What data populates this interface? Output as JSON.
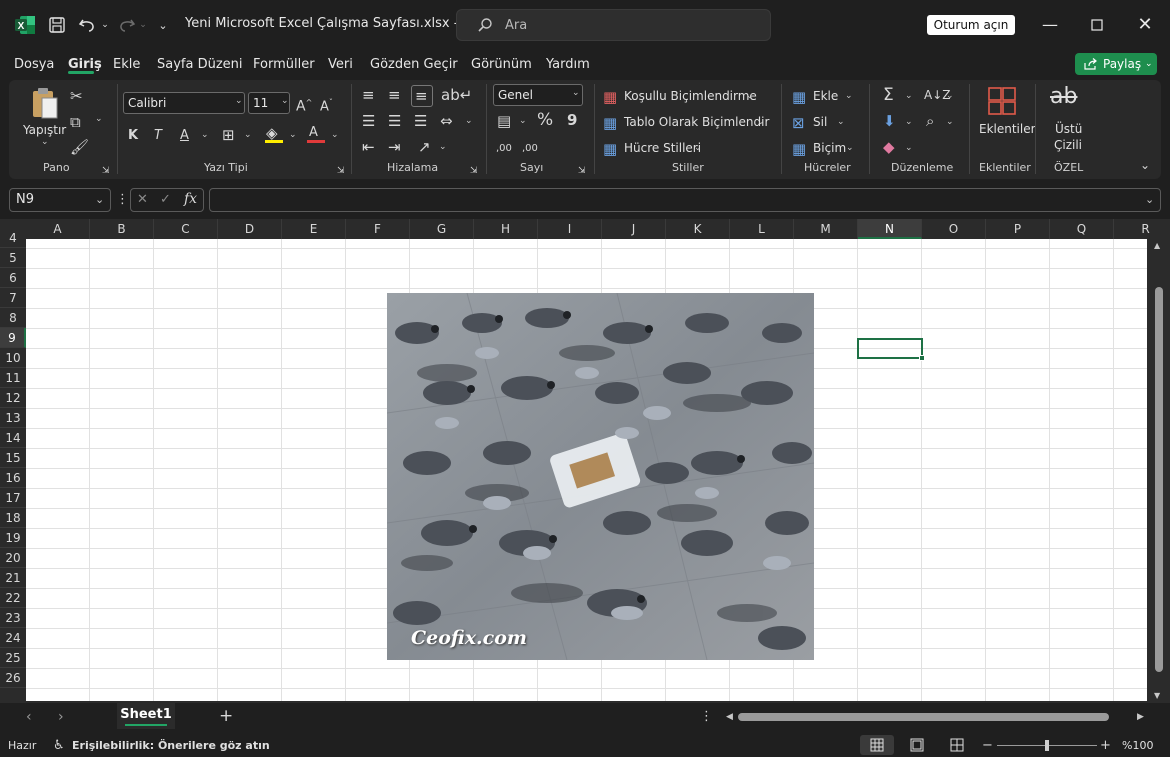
{
  "title": {
    "doc": "Yeni Microsoft Excel Çalışma Sayfası.xlsx  -  E...",
    "search_placeholder": "Ara",
    "signin": "Oturum açın"
  },
  "menu": [
    "Dosya",
    "Giriş",
    "Ekle",
    "Sayfa Düzeni",
    "Formüller",
    "Veri",
    "Gözden Geçir",
    "Görünüm",
    "Yardım"
  ],
  "share": "Paylaş",
  "ribbon": {
    "paste": "Yapıştır",
    "font_name": "Calibri",
    "font_size": "11",
    "bold": "K",
    "italic": "T",
    "underline": "A",
    "font_color": "A",
    "number_format": "Genel",
    "percent": "%",
    "comma": "9",
    "dec_inc": ",00",
    "dec_dec": ",00",
    "cond_format": "Koşullu Biçimlendirme",
    "table_format": "Tablo Olarak Biçimlendir",
    "cell_styles": "Hücre Stilleri",
    "insert": "Ekle",
    "delete": "Sil",
    "format": "Biçim",
    "addins": "Eklentiler",
    "strike_line1": "Üstü",
    "strike_line2": "Çizili",
    "groups": {
      "pano": "Pano",
      "font": "Yazı Tipi",
      "align": "Hizalama",
      "number": "Sayı",
      "styles": "Stiller",
      "cells": "Hücreler",
      "editing": "Düzenleme",
      "addins": "Eklentiler",
      "custom": "ÖZEL"
    }
  },
  "name_box": "N9",
  "columns": [
    "A",
    "B",
    "C",
    "D",
    "E",
    "F",
    "G",
    "H",
    "I",
    "J",
    "K",
    "L",
    "M",
    "N",
    "O",
    "P",
    "Q",
    "R"
  ],
  "rows": [
    "4",
    "5",
    "6",
    "7",
    "8",
    "9",
    "10",
    "11",
    "12",
    "13",
    "14",
    "15",
    "16",
    "17",
    "18",
    "19",
    "20",
    "21",
    "22",
    "23",
    "24",
    "25",
    "26"
  ],
  "selected_column": "N",
  "selected_row": "9",
  "image_watermark": "Ceofix.com",
  "sheet_tab": "Sheet1",
  "status": {
    "ready": "Hazır",
    "accessibility": "Erişilebilirlik: Önerilere göz atın",
    "zoom": "%100"
  },
  "colors": {
    "accent": "#1e7145",
    "share": "#1e8e4e",
    "tab_underline": "#22a565"
  }
}
